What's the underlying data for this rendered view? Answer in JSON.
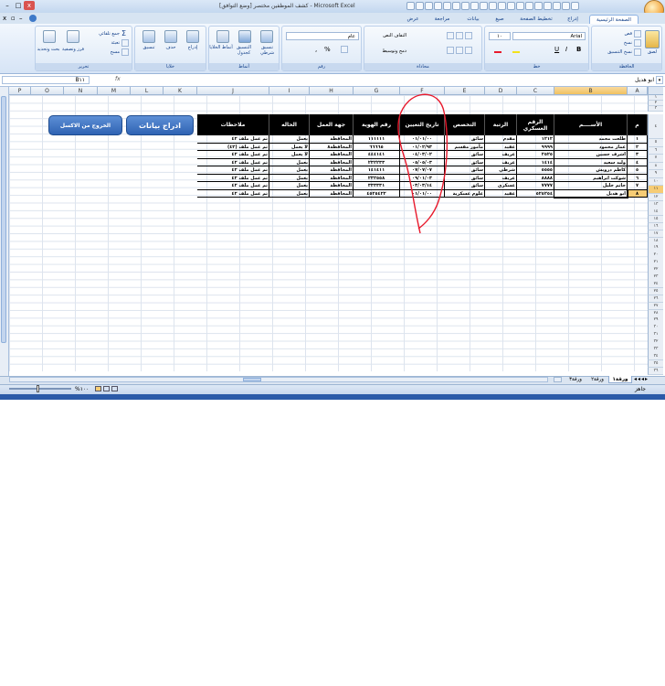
{
  "window": {
    "title": "كشف الموظفين مختصر [وضع التوافق] - Microsoft Excel",
    "minimize": "–",
    "maximize": "□",
    "close": "x"
  },
  "ribbon_tabs": [
    "الصفحة الرئيسية",
    "إدراج",
    "تخطيط الصفحة",
    "صيغ",
    "بيانات",
    "مراجعة",
    "عرض"
  ],
  "ribbon": {
    "clipboard": {
      "label": "الحافظة",
      "paste": "لصق",
      "cut": "قص",
      "copy": "نسخ",
      "format_painter": "نسخ التنسيق"
    },
    "font": {
      "label": "خط",
      "name": "Arial",
      "size": "١٠",
      "bold": "B",
      "italic": "I",
      "underline": "U"
    },
    "alignment": {
      "label": "محاذاة",
      "wrap": "التفاف النص",
      "merge": "دمج وتوسيط"
    },
    "number": {
      "label": "رقم",
      "format": "عام",
      "percent": "%",
      "comma": ","
    },
    "styles": {
      "label": "أنماط",
      "conditional": "تنسيق شرطي",
      "as_table": "التنسيق كجدول",
      "cell_styles": "أنماط الخلايا"
    },
    "cells": {
      "label": "خلايا",
      "insert": "إدراج",
      "delete": "حذف",
      "format": "تنسيق"
    },
    "editing": {
      "label": "تحرير",
      "autosum": "جمع تلقائي",
      "fill": "تعبئة",
      "clear": "مسح",
      "sort": "فرز وتصفية",
      "find": "بحث وتحديد"
    }
  },
  "formula_bar": {
    "name_box": "B١١",
    "fx": "fx",
    "value": "ابو هديل"
  },
  "columns": [
    "A",
    "B",
    "C",
    "D",
    "E",
    "F",
    "G",
    "H",
    "I",
    "J",
    "K",
    "L",
    "M",
    "N",
    "O",
    "P"
  ],
  "rows": [
    "١",
    "٢",
    "٣",
    "٤",
    "٥",
    "٦",
    "٧",
    "٨",
    "٩",
    "١٠",
    "١١",
    "١٢",
    "١٣",
    "١٤",
    "١٥",
    "١٦",
    "١٧",
    "١٨",
    "١٩",
    "٢٠",
    "٢١",
    "٢٢",
    "٢٣",
    "٢٤",
    "٢٥",
    "٢٦",
    "٢٧",
    "٢٨",
    "٢٩",
    "٣٠",
    "٣١",
    "٣٢",
    "٣٣",
    "٣٤",
    "٣٥",
    "٣٦"
  ],
  "table": {
    "headers": {
      "num": "م",
      "name": "الأســــم",
      "mil": "الرقم العسكري",
      "rank": "الرتبة",
      "spec": "التخصص",
      "date": "تاريخ التعيين",
      "id": "رقم الهوية",
      "work": "جهة العمل",
      "status": "الحاله",
      "notes": "ملاحظات"
    },
    "rows": [
      {
        "num": "١",
        "name": "طلعت محمد",
        "mil": "١٢١٢",
        "rank": "مقدم",
        "spec": "سائق",
        "date": "٠١/٠١/٠٠",
        "id": "١١١١١١",
        "work": "المحافظة",
        "status": "يعمل",
        "notes": "تم عمل ملف ٤٢"
      },
      {
        "num": "٢",
        "name": "عمار محمود",
        "mil": "٩٩٩٩",
        "rank": "عقيد",
        "spec": "مأمور مقسم",
        "date": "٠١/٠٢/٩٣",
        "id": "٦٦٦٦٥",
        "work": "المحافظة٨",
        "status": "لا يعمل",
        "notes": "تم عمل ملف (٤٢)"
      },
      {
        "num": "٣",
        "name": "اشرف حسين",
        "mil": "٢٥٢٥",
        "rank": "عريف",
        "spec": "سائق",
        "date": "٠٤/٠٣/٠٢",
        "id": "٤٤٤١٤١",
        "work": "المحافظة",
        "status": "لا يعمل",
        "notes": "تم عمل ملف ٤٢"
      },
      {
        "num": "٤",
        "name": "وليد سعيد",
        "mil": "١٤١٤",
        "rank": "عريف",
        "spec": "سائق",
        "date": "٠٥/٠٥/٠٣",
        "id": "٢٣٢٢٣٣",
        "work": "المحافظة",
        "status": "يعمل",
        "notes": "تم عمل ملف ٤٢"
      },
      {
        "num": "٥",
        "name": "كاظم درويش",
        "mil": "٥٥٥٥",
        "rank": "شرطي",
        "spec": "سائق",
        "date": "٠٧/٠٧/٠٧",
        "id": "١٤١٤١١",
        "work": "المحافظة",
        "status": "يعمل",
        "notes": "تم عمل ملف ٤٢"
      },
      {
        "num": "٦",
        "name": "شوكت ابراهيم",
        "mil": "٨٨٨٨",
        "rank": "عريف",
        "spec": "سائق",
        "date": "٠٩/٠١/٠٣",
        "id": "٢٣٢٥٥٨",
        "work": "المحافظة",
        "status": "يعمل",
        "notes": "تم عمل ملف ٤٢"
      },
      {
        "num": "٧",
        "name": "حاتم خليل",
        "mil": "٧٧٧٧",
        "rank": "عسكري",
        "spec": "سائق",
        "date": "٠٣/٠٣/١٤",
        "id": "٣٣٣٣٣١",
        "work": "المحافظة",
        "status": "يعمل",
        "notes": "تم عمل ملف ٤٢"
      },
      {
        "num": "٨",
        "name": "ابو هديل",
        "mil": "٥٢٥٢٥٤",
        "rank": "عقيد",
        "spec": "علوم عسكرية",
        "date": "٠١/٠١/٠٠",
        "id": "٤٥٢٥٤٢٢",
        "work": "المحافظة",
        "status": "يعمل",
        "notes": "تم عمل ملف ٤٢"
      }
    ]
  },
  "macros": {
    "insert": "ادراج بيانات",
    "exit": "الخروج من الاكسل"
  },
  "sheet_tabs": [
    "ورقة١",
    "ورقة٢",
    "ورقة٣"
  ],
  "status": {
    "ready": "جاهز",
    "zoom": "%١٠٠"
  },
  "colors": {
    "selection": "#f6cc75",
    "annotation": "#e8192c",
    "ribbon": "#dbe8f7",
    "header_bg": "#000000",
    "macro_btn": "#3b6fc0"
  }
}
